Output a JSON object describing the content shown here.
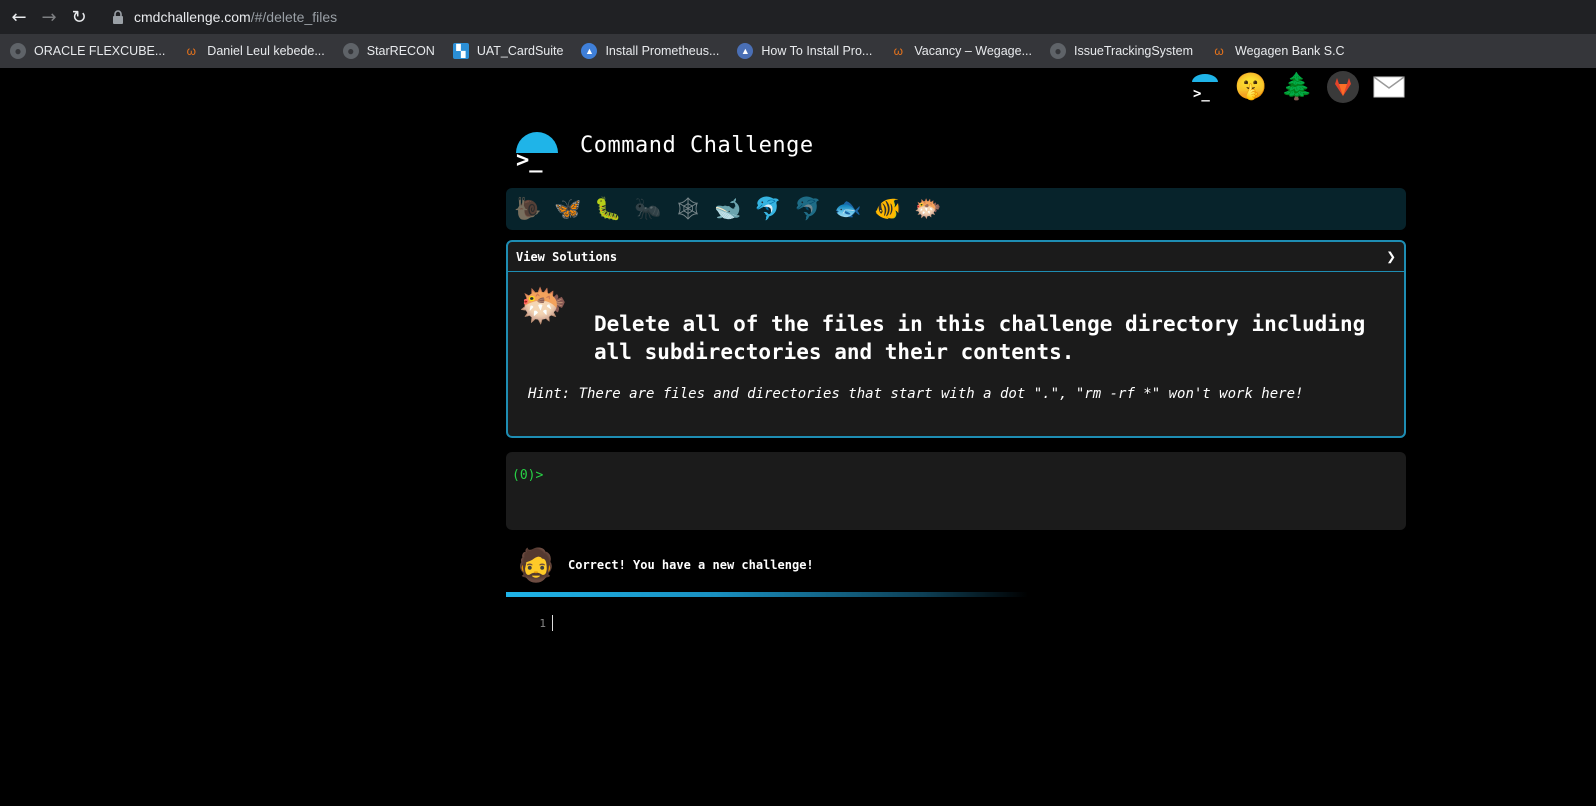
{
  "browser": {
    "url_host": "cmdchallenge.com",
    "url_path": "/#/delete_files",
    "bookmarks": [
      {
        "label": "ORACLE FLEXCUBE...",
        "icon": "globe-icon"
      },
      {
        "label": "Daniel Leul kebede...",
        "icon": "wegagen-icon"
      },
      {
        "label": "StarRECON",
        "icon": "globe-icon"
      },
      {
        "label": "UAT_CardSuite",
        "icon": "cardsuite-icon"
      },
      {
        "label": "Install Prometheus...",
        "icon": "blue-icon"
      },
      {
        "label": "How To Install Pro...",
        "icon": "blue-icon"
      },
      {
        "label": "Vacancy – Wegage...",
        "icon": "wegagen-icon"
      },
      {
        "label": "IssueTrackingSystem",
        "icon": "globe-icon"
      },
      {
        "label": "Wegagen Bank S.C",
        "icon": "wegagen-icon"
      }
    ]
  },
  "page": {
    "brand_title": "Command Challenge",
    "logo_prompt": ">_",
    "top_icons": [
      "terminal-logo-icon",
      "shushing-face-icon",
      "tree-icon",
      "gitlab-icon",
      "envelope-icon"
    ],
    "levels": [
      "🐌",
      "🦋",
      "🐛",
      "🐜",
      "🕸",
      "🐋",
      "🐬",
      "🐬",
      "🐟",
      "🐠",
      "🐡"
    ],
    "challenge": {
      "view_solutions": "View Solutions",
      "text": "Delete all of the files in this challenge directory including all subdirectories and their contents.",
      "hint": "Hint: There are files and directories that start with a dot \".\", \"rm -rf *\" won't work here!"
    },
    "terminal": {
      "prompt": "(0)>"
    },
    "feedback": {
      "text": "Correct! You have a new challenge!"
    },
    "progress_fraction": 0.58,
    "editor": {
      "line_number": "1"
    }
  },
  "colors": {
    "accent": "#1fb4e8",
    "prompt": "#27d145",
    "panel": "#1b1b1b"
  }
}
